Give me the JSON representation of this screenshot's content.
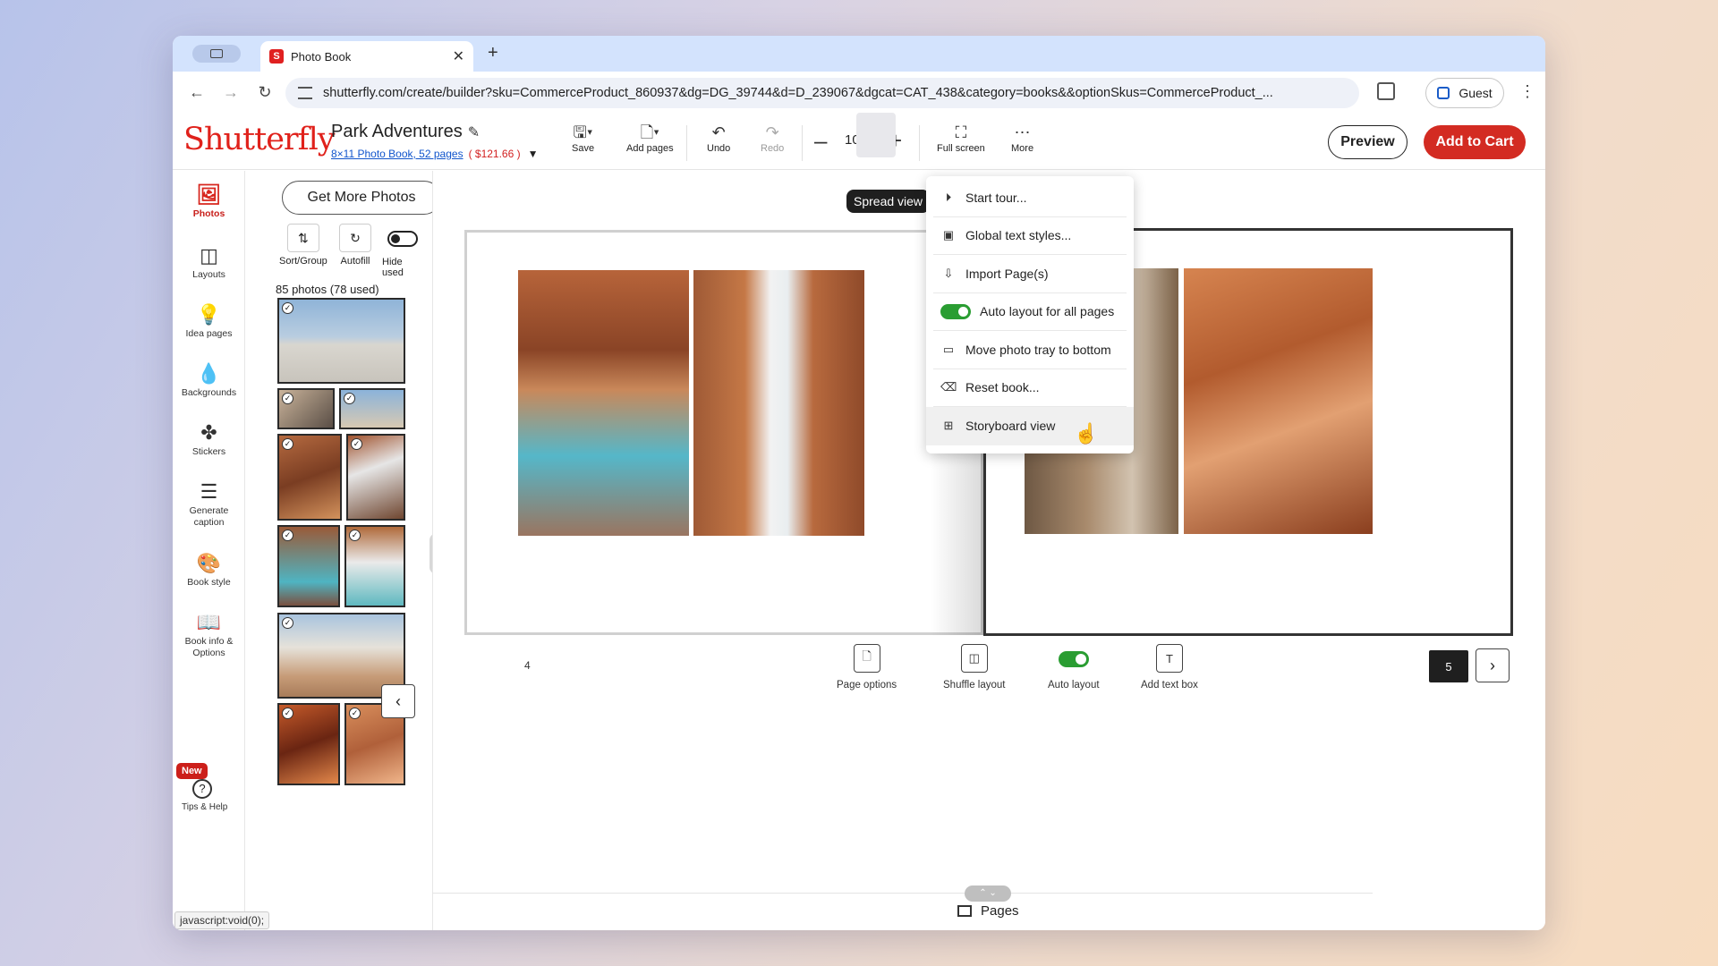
{
  "browser": {
    "tab_title": "Photo Book",
    "tab_favicon_letter": "S",
    "tab_close": "✕",
    "new_tab": "+",
    "url": "shutterfly.com/create/builder?sku=CommerceProduct_860937&dg=DG_39744&d=D_239067&dgcat=CAT_438&category=books&&optionSkus=CommerceProduct_...",
    "profile_label": "Guest",
    "status_url": "javascript:void(0);"
  },
  "header": {
    "logo": "Shutterfly",
    "project_name": "Park Adventures",
    "product_link": "8×11 Photo Book, 52 pages",
    "price": "( $121.66 )",
    "tools": {
      "save": "Save",
      "add_pages": "Add pages",
      "undo": "Undo",
      "redo": "Redo",
      "zoom": "100%",
      "full_screen": "Full screen",
      "more": "More"
    },
    "preview": "Preview",
    "add_to_cart": "Add to Cart"
  },
  "rail": {
    "items": [
      {
        "label": "Photos",
        "icon": "photos-icon"
      },
      {
        "label": "Layouts",
        "icon": "layouts-icon"
      },
      {
        "label": "Idea pages",
        "icon": "lightbulb-icon"
      },
      {
        "label": "Backgrounds",
        "icon": "droplet-icon"
      },
      {
        "label": "Stickers",
        "icon": "sticker-icon"
      },
      {
        "label": "Generate caption",
        "icon": "caption-icon"
      },
      {
        "label": "Book style",
        "icon": "palette-icon"
      },
      {
        "label": "Book info & Options",
        "icon": "book-icon"
      }
    ],
    "new_badge": "New",
    "help_label": "Tips & Help"
  },
  "tray": {
    "get_more": "Get More Photos",
    "sort_group": "Sort/Group",
    "autofill": "Autofill",
    "hide_used": "Hide used",
    "count": "85 photos (78 used)"
  },
  "canvas": {
    "spread_view": "Spread view",
    "left_page_number": "4",
    "right_page_number": "5",
    "tools": {
      "page_options": "Page options",
      "shuffle_layout": "Shuffle layout",
      "auto_layout": "Auto layout",
      "add_text_box": "Add text box"
    },
    "pages_label": "Pages"
  },
  "menu": {
    "items": [
      {
        "label": "Start tour...",
        "icon": "play-icon"
      },
      {
        "label": "Global text styles...",
        "icon": "text-style-icon"
      },
      {
        "label": "Import Page(s)",
        "icon": "import-icon"
      },
      {
        "label": "Auto layout for all pages",
        "icon": "toggle-on"
      },
      {
        "label": "Move photo tray to bottom",
        "icon": "tray-icon"
      },
      {
        "label": "Reset book...",
        "icon": "eraser-icon"
      },
      {
        "label": "Storyboard view",
        "icon": "grid-icon"
      }
    ]
  },
  "colors": {
    "brand_red": "#d32b22",
    "toggle_green": "#2a9d32",
    "link_blue": "#1155cc"
  }
}
